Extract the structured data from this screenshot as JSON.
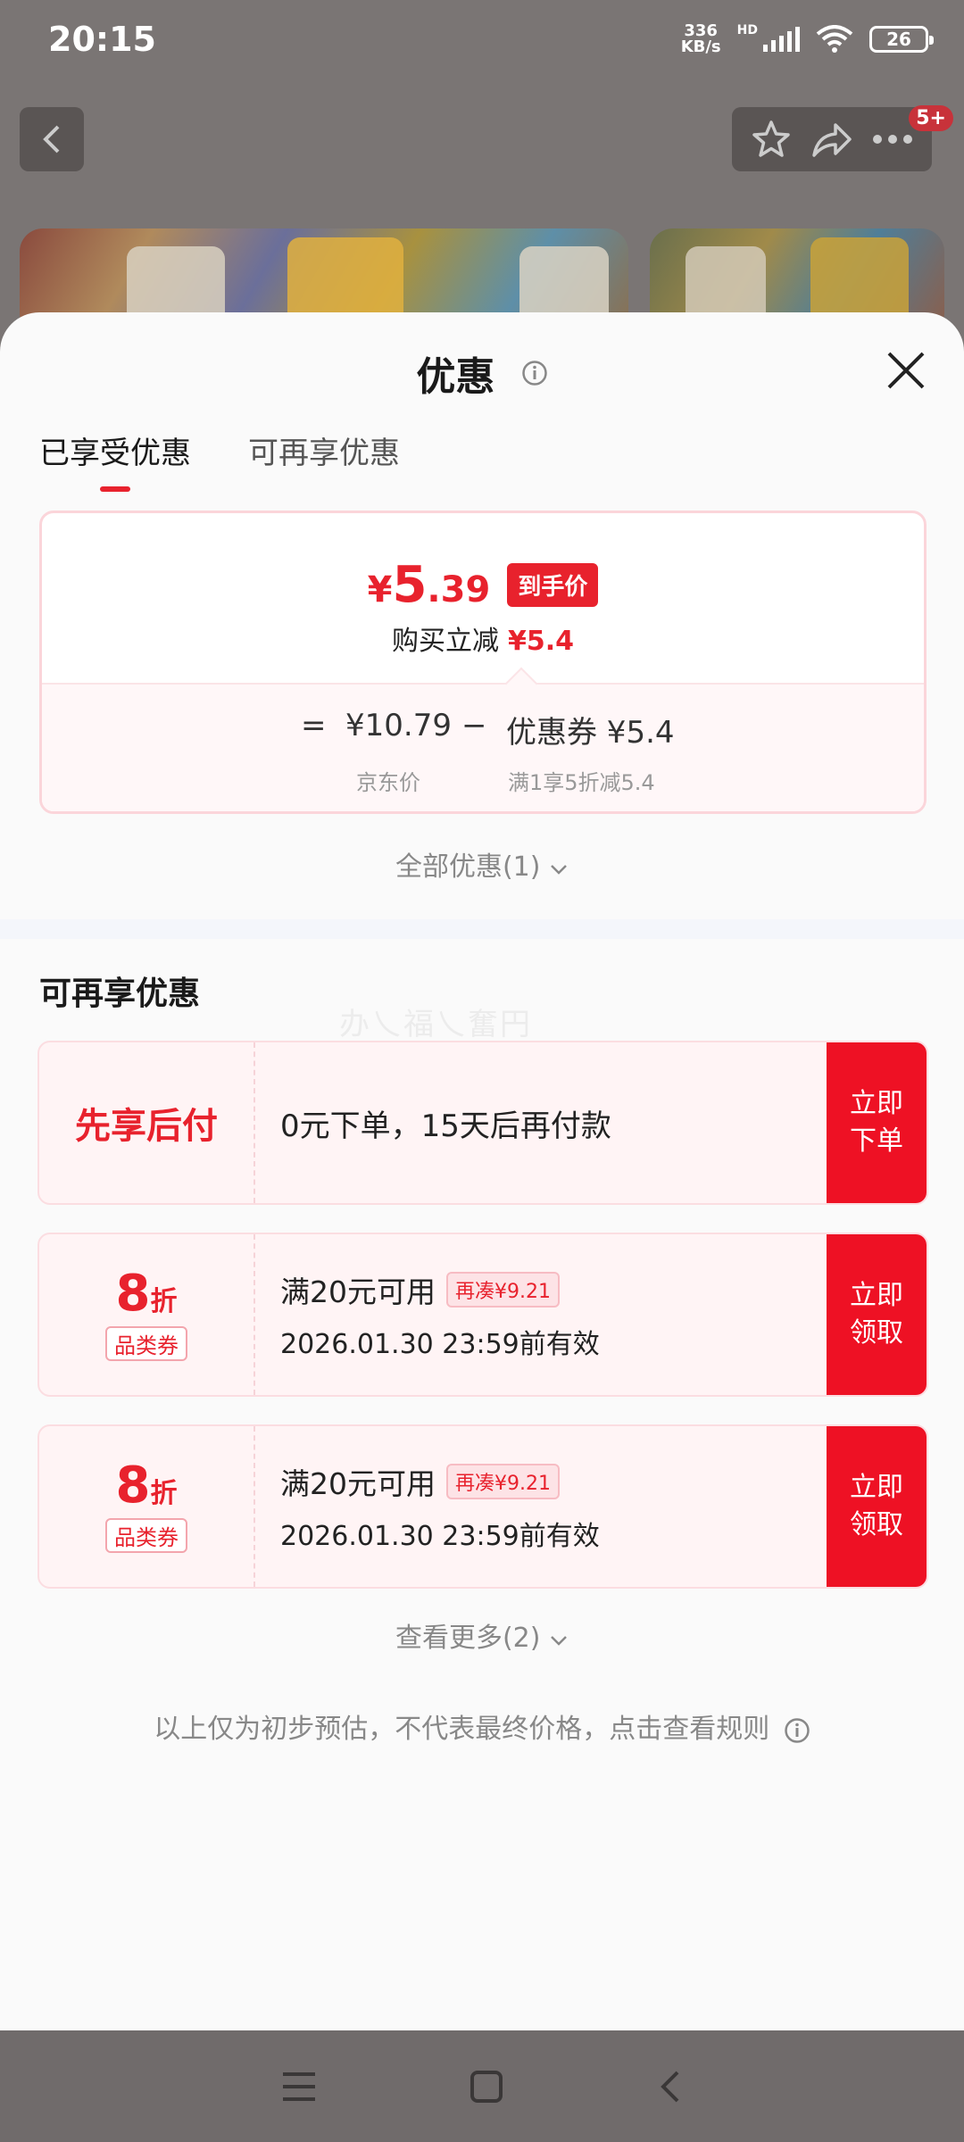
{
  "status": {
    "time": "20:15",
    "net_speed_top": "336",
    "net_speed_bottom": "KB/s",
    "hd": "HD",
    "battery": "26"
  },
  "header": {
    "badge": "5+"
  },
  "sheet": {
    "title": "优惠",
    "tabs": [
      {
        "label": "已享受优惠",
        "active": true
      },
      {
        "label": "可再享优惠",
        "active": false
      }
    ],
    "price": {
      "currency": "¥",
      "integer": "5",
      "decimal": ".39",
      "tag": "到手价",
      "instant_label": "购买立减",
      "instant_amount": "¥5.4",
      "equals": "=",
      "jd_price": "¥10.79",
      "minus": "−",
      "coupon": "优惠券 ¥5.4",
      "jd_price_label": "京东价",
      "coupon_label": "满1享5折减5.4"
    },
    "all_discounts": "全部优惠(1)",
    "section_title": "可再享优惠",
    "watermark": "办乀福乀奮円",
    "offers": [
      {
        "left": "先享后付",
        "main": "0元下单，15天后再付款",
        "action": "立即下单"
      },
      {
        "discount": "8",
        "unit": "折",
        "tag": "品类券",
        "condition": "满20元可用",
        "pill": "再凑¥9.21",
        "validity": "2026.01.30 23:59前有效",
        "action": "立即领取"
      },
      {
        "discount": "8",
        "unit": "折",
        "tag": "品类券",
        "condition": "满20元可用",
        "pill": "再凑¥9.21",
        "validity": "2026.01.30 23:59前有效",
        "action": "立即领取"
      }
    ],
    "see_more": "查看更多(2)",
    "disclaimer": "以上仅为初步预估，不代表最终价格，点击查看规则"
  },
  "colors": {
    "accent": "#e8222d",
    "button": "#ee1124"
  }
}
